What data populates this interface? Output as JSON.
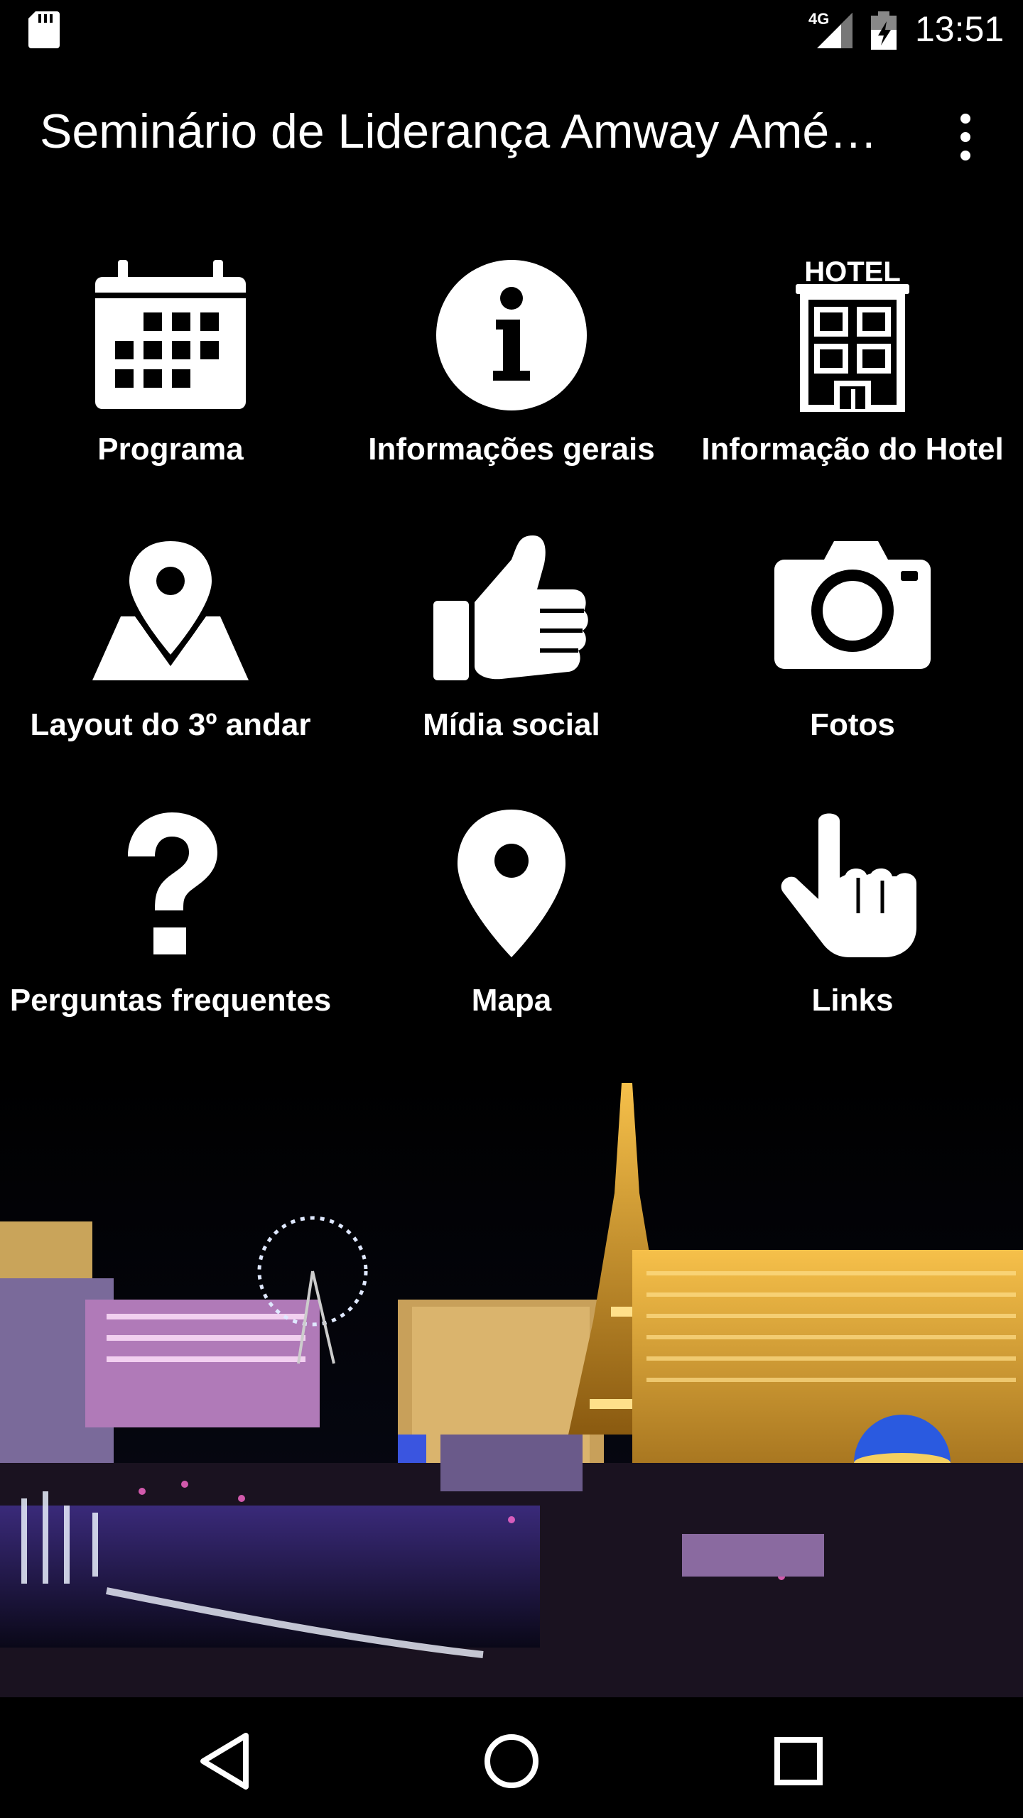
{
  "status_bar": {
    "network": "4G",
    "time": "13:51",
    "icons": [
      "sd-card-icon",
      "signal-icon",
      "battery-charging-icon"
    ]
  },
  "app_bar": {
    "title": "Seminário de Liderança Amway Amé…",
    "overflow_icon": "more-vert-icon"
  },
  "menu": [
    {
      "label": "Programa",
      "icon": "calendar-icon"
    },
    {
      "label": "Informações gerais",
      "icon": "info-icon"
    },
    {
      "label": "Informação do Hotel",
      "icon": "hotel-icon",
      "icon_text": "HOTEL"
    },
    {
      "label": "Layout do 3º andar",
      "icon": "map-pin-icon"
    },
    {
      "label": "Mídia social",
      "icon": "thumbs-up-icon"
    },
    {
      "label": "Fotos",
      "icon": "camera-icon"
    },
    {
      "label": "Perguntas frequentes",
      "icon": "question-icon"
    },
    {
      "label": "Mapa",
      "icon": "location-pin-icon"
    },
    {
      "label": "Links",
      "icon": "pointing-hand-icon"
    }
  ],
  "nav_bar": {
    "icons": [
      "back-icon",
      "home-icon",
      "recents-icon"
    ]
  },
  "colors": {
    "background": "#000000",
    "text": "#ffffff"
  }
}
